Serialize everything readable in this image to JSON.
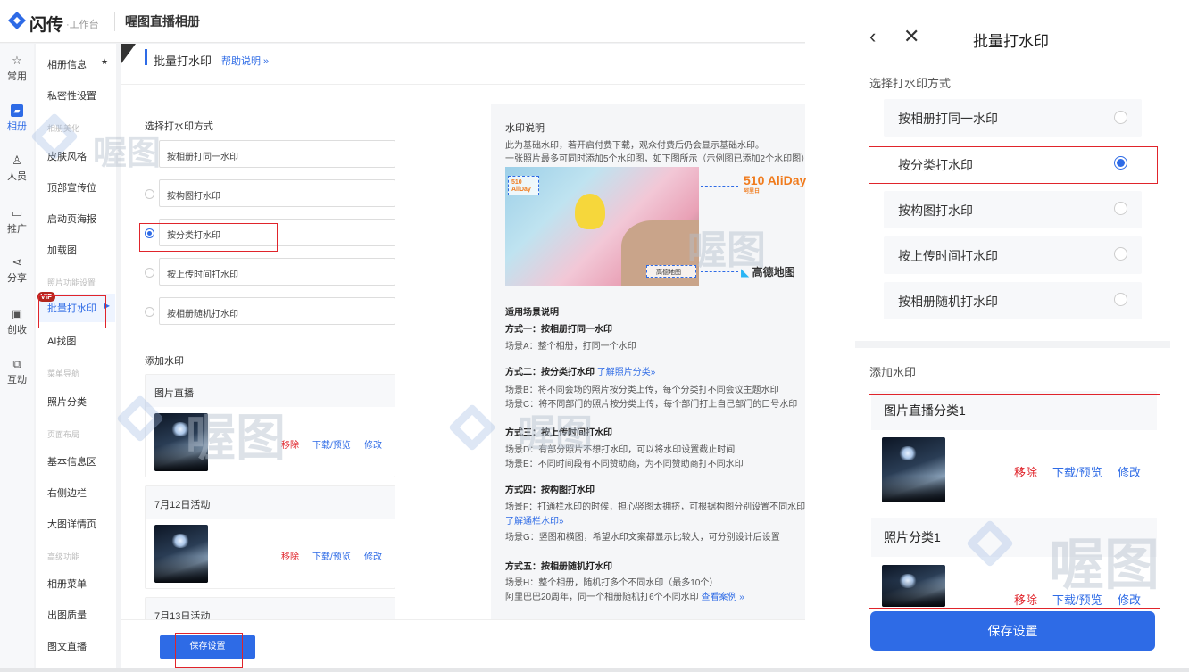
{
  "header": {
    "brand": "闪传",
    "brand_sub": "·工作台",
    "app_title": "喔图直播相册"
  },
  "nav": [
    {
      "label": "常用",
      "icon": "star-icon"
    },
    {
      "label": "相册",
      "icon": "album-icon"
    },
    {
      "label": "人员",
      "icon": "person-icon"
    },
    {
      "label": "推广",
      "icon": "promote-icon"
    },
    {
      "label": "分享",
      "icon": "share-icon"
    },
    {
      "label": "创收",
      "icon": "revenue-icon"
    },
    {
      "label": "互动",
      "icon": "interact-icon"
    }
  ],
  "submenu": {
    "album_info": "相册信息",
    "privacy": "私密性设置",
    "grp_style": "相册美化",
    "skin": "皮肤风格",
    "top_banner": "顶部宣传位",
    "launch_poster": "启动页海报",
    "loading": "加载图",
    "grp_photo": "照片功能设置",
    "batch_watermark": "批量打水印",
    "vip_badge": "VIP",
    "ai_find": "AI找图",
    "grp_menu": "菜单导航",
    "photo_category": "照片分类",
    "grp_layout": "页面布局",
    "basic_info": "基本信息区",
    "right_sidebar": "右侧边栏",
    "detail_page": "大图详情页",
    "grp_advanced": "高级功能",
    "album_menu": "相册菜单",
    "output_quality": "出图质量",
    "graphic_live": "图文直播"
  },
  "main": {
    "section_title": "批量打水印",
    "help_link": "帮助说明 »",
    "choose_label": "选择打水印方式",
    "options": [
      "按相册打同一水印",
      "按构图打水印",
      "按分类打水印",
      "按上传时间打水印",
      "按相册随机打水印"
    ],
    "selected_option": "按分类打水印",
    "add_label": "添加水印",
    "cards": [
      {
        "title": "图片直播",
        "remove": "移除",
        "download": "下载/预览",
        "edit": "修改"
      },
      {
        "title": "7月12日活动",
        "remove": "移除",
        "download": "下载/预览",
        "edit": "修改"
      },
      {
        "title": "7月13日活动"
      }
    ],
    "save": "保存设置"
  },
  "watermark_info": {
    "title": "水印说明",
    "line1": "此为基础水印，若开启付费下载，观众付费后仍会显示基础水印。",
    "line2": "一张照片最多可同时添加5个水印图，如下图所示（示例图已添加2个水印图）",
    "sample_logo1": "510 AliDay",
    "sample_logo1_sub": "阿里日",
    "sample_logo2": "高德地图",
    "scenes_title": "适用场景说明",
    "m1_title": "方式一：按相册打同一水印",
    "m1_a": "场景A：整个相册，打同一个水印",
    "m2_title": "方式二：按分类打水印",
    "m2_link": "了解照片分类»",
    "m2_b": "场景B：将不同会场的照片按分类上传，每个分类打不同会议主题水印",
    "m2_c": "场景C：将不同部门的照片按分类上传，每个部门打上自己部门的口号水印",
    "m3_title": "方式三：按上传时间打水印",
    "m3_d": "场景D：有部分照片不想打水印，可以将水印设置截止时间",
    "m3_e": "场景E：不同时间段有不同赞助商，为不同赞助商打不同水印",
    "m4_title": "方式四：按构图打水印",
    "m4_f": "场景F：打通栏水印的时候，担心竖图太拥挤，可根据构图分别设置不同水印",
    "m4_link": "了解通栏水印»",
    "m4_g": "场景G：竖图和横图，希望水印文案都显示比较大，可分别设计后设置",
    "m5_title": "方式五：按相册随机打水印",
    "m5_h": "场景H：整个相册，随机打多个不同水印（最多10个）",
    "m5_ali": "阿里巴巴20周年，同一个相册随机打6个不同水印",
    "m5_link": "查看案例 »"
  },
  "mobile": {
    "title": "批量打水印",
    "choose_label": "选择打水印方式",
    "options": [
      "按相册打同一水印",
      "按分类打水印",
      "按构图打水印",
      "按上传时间打水印",
      "按相册随机打水印"
    ],
    "selected_option": "按分类打水印",
    "add_label": "添加水印",
    "cards": [
      {
        "title": "图片直播分类1",
        "remove": "移除",
        "download": "下载/预览",
        "edit": "修改"
      },
      {
        "title": "照片分类1",
        "remove": "移除",
        "download": "下载/预览",
        "edit": "修改"
      }
    ],
    "save": "保存设置"
  },
  "watermark_text": "喔图",
  "colors": {
    "accent": "#2e6be6",
    "danger": "#e0242b",
    "highlight_box": "#e0242b"
  }
}
